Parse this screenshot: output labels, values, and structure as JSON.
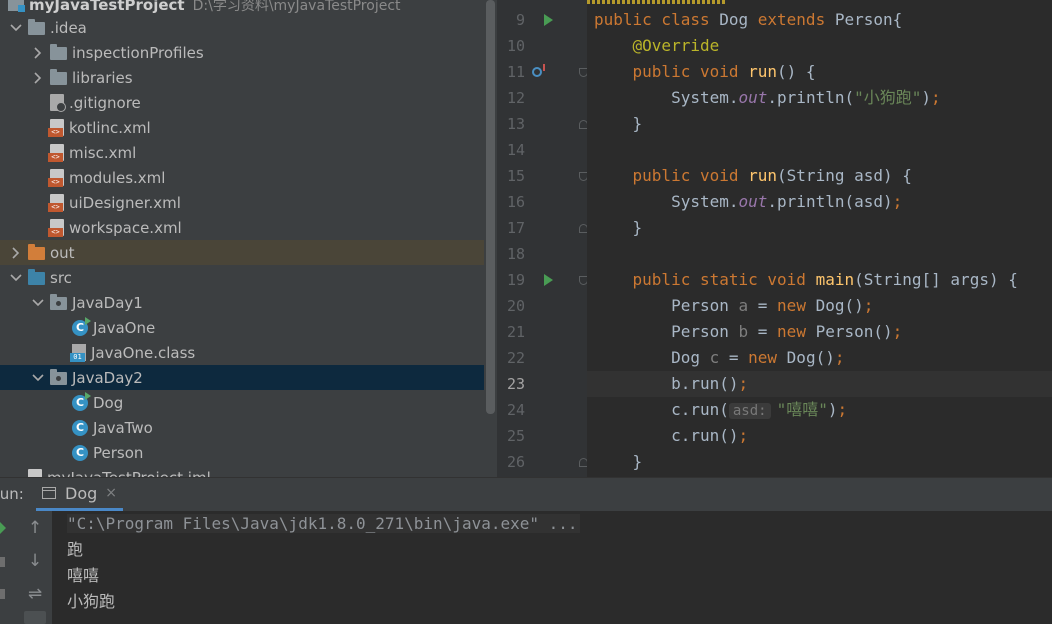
{
  "project_tree": {
    "root": {
      "name": "myJavaTestProject",
      "path": "D:\\学习资料\\myJavaTestProject"
    },
    "items": [
      {
        "label": ".idea",
        "icon": "folder-icon",
        "expanded": true
      },
      {
        "label": "inspectionProfiles",
        "icon": "folder-icon",
        "expanded": false
      },
      {
        "label": "libraries",
        "icon": "folder-icon",
        "expanded": false
      },
      {
        "label": ".gitignore",
        "icon": "gitignore-file-icon"
      },
      {
        "label": "kotlinc.xml",
        "icon": "xml-file-icon"
      },
      {
        "label": "misc.xml",
        "icon": "xml-file-icon"
      },
      {
        "label": "modules.xml",
        "icon": "xml-file-icon"
      },
      {
        "label": "uiDesigner.xml",
        "icon": "xml-file-icon"
      },
      {
        "label": "workspace.xml",
        "icon": "xml-file-icon"
      },
      {
        "label": "out",
        "icon": "excluded-folder-icon",
        "expanded": false
      },
      {
        "label": "src",
        "icon": "source-folder-icon",
        "expanded": true
      },
      {
        "label": "JavaDay1",
        "icon": "package-icon",
        "expanded": true
      },
      {
        "label": "JavaOne",
        "icon": "runnable-class-icon"
      },
      {
        "label": "JavaOne.class",
        "icon": "class-file-icon"
      },
      {
        "label": "JavaDay2",
        "icon": "package-icon",
        "expanded": true,
        "selected": true
      },
      {
        "label": "Dog",
        "icon": "runnable-class-icon"
      },
      {
        "label": "JavaTwo",
        "icon": "class-icon"
      },
      {
        "label": "Person",
        "icon": "class-icon"
      },
      {
        "label": "myJavaTestProject.iml",
        "icon": "module-file-icon"
      }
    ]
  },
  "editor": {
    "current_line": 23,
    "lines": [
      {
        "num": "9",
        "tokens": [
          [
            "kw",
            "public class "
          ],
          [
            "",
            "Dog "
          ],
          [
            "kw",
            "extends "
          ],
          [
            "",
            "Person{"
          ]
        ]
      },
      {
        "num": "10",
        "tokens": [
          [
            "an",
            "    @Override"
          ]
        ]
      },
      {
        "num": "11",
        "tokens": [
          [
            "kw",
            "    public void "
          ],
          [
            "fn",
            "run"
          ],
          [
            "",
            "() {"
          ]
        ]
      },
      {
        "num": "12",
        "tokens": [
          [
            "",
            "        System."
          ],
          [
            "it",
            "out"
          ],
          [
            "",
            ".println("
          ],
          [
            "st",
            "\"小狗跑\""
          ],
          [
            "",
            ")"
          ],
          [
            "kw",
            ";"
          ]
        ]
      },
      {
        "num": "13",
        "tokens": [
          [
            "",
            "    }"
          ]
        ]
      },
      {
        "num": "14",
        "tokens": []
      },
      {
        "num": "15",
        "tokens": [
          [
            "kw",
            "    public void "
          ],
          [
            "fn",
            "run"
          ],
          [
            "",
            "(String asd) {"
          ]
        ]
      },
      {
        "num": "16",
        "tokens": [
          [
            "",
            "        System."
          ],
          [
            "it",
            "out"
          ],
          [
            "",
            ".println(asd)"
          ],
          [
            "kw",
            ";"
          ]
        ]
      },
      {
        "num": "17",
        "tokens": [
          [
            "",
            "    }"
          ]
        ]
      },
      {
        "num": "18",
        "tokens": []
      },
      {
        "num": "19",
        "tokens": [
          [
            "kw",
            "    public static void "
          ],
          [
            "fn",
            "main"
          ],
          [
            "",
            "(String[] args) {"
          ]
        ]
      },
      {
        "num": "20",
        "tokens": [
          [
            "",
            "        Person "
          ],
          [
            "dim",
            "a"
          ],
          [
            "",
            " = "
          ],
          [
            "kw",
            "new "
          ],
          [
            "",
            "Dog()"
          ],
          [
            "kw",
            ";"
          ]
        ]
      },
      {
        "num": "21",
        "tokens": [
          [
            "",
            "        Person "
          ],
          [
            "dim",
            "b"
          ],
          [
            "",
            " = "
          ],
          [
            "kw",
            "new "
          ],
          [
            "",
            "Person()"
          ],
          [
            "kw",
            ";"
          ]
        ]
      },
      {
        "num": "22",
        "tokens": [
          [
            "",
            "        Dog "
          ],
          [
            "dim",
            "c"
          ],
          [
            "",
            " = "
          ],
          [
            "kw",
            "new "
          ],
          [
            "",
            "Dog()"
          ],
          [
            "kw",
            ";"
          ]
        ]
      },
      {
        "num": "23",
        "tokens": [
          [
            "",
            "        b.run()"
          ],
          [
            "kw",
            ";"
          ]
        ]
      },
      {
        "num": "24",
        "tokens": [
          [
            "",
            "        c.run("
          ],
          [
            "hint",
            "asd:"
          ],
          [
            "st",
            "\"嘻嘻\""
          ],
          [
            "",
            ")"
          ],
          [
            "kw",
            ";"
          ]
        ]
      },
      {
        "num": "25",
        "tokens": [
          [
            "",
            "        c.run()"
          ],
          [
            "kw",
            ";"
          ]
        ]
      },
      {
        "num": "26",
        "tokens": [
          [
            "",
            "    }"
          ]
        ]
      }
    ]
  },
  "run_panel": {
    "label": "Run:",
    "tab_label": "Dog",
    "close_glyph": "×",
    "output": [
      "\"C:\\Program Files\\Java\\jdk1.8.0_271\\bin\\java.exe\" ...",
      "跑",
      "嘻嘻",
      "小狗跑"
    ]
  },
  "colors": {
    "keyword": "#cc7832",
    "method": "#ffc66d",
    "annotation": "#bbb529",
    "string": "#6a8759",
    "static_field": "#9876aa",
    "selection": "#0d293e",
    "run_icon": "#499c54"
  }
}
